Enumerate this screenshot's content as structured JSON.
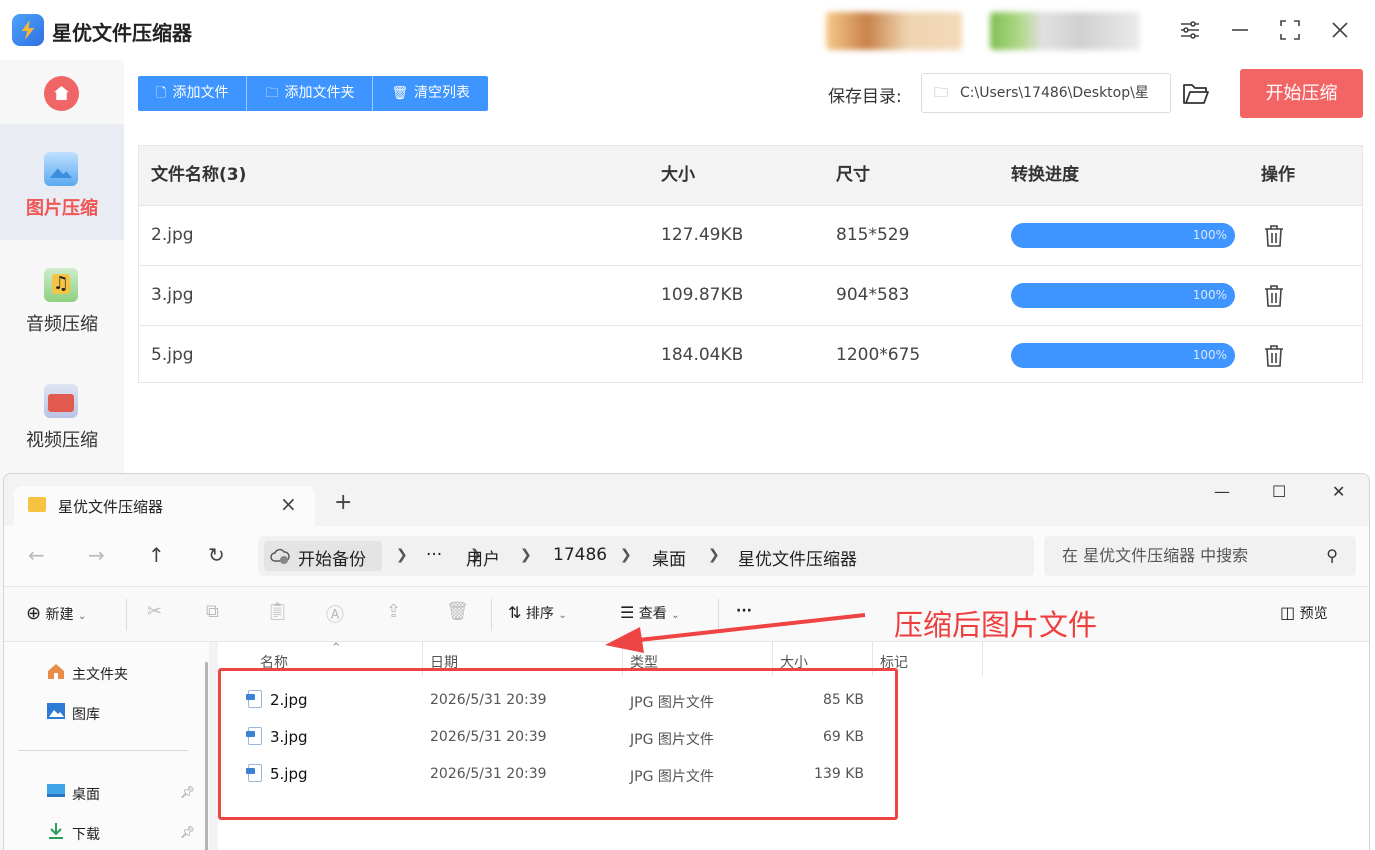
{
  "app": {
    "title": "星优文件压缩器",
    "sidebar": {
      "items": [
        {
          "label": "图片压缩",
          "active": true
        },
        {
          "label": "音频压缩",
          "active": false
        },
        {
          "label": "视频压缩",
          "active": false
        }
      ]
    },
    "toolbar": {
      "add_file": "添加文件",
      "add_folder": "添加文件夹",
      "clear_list": "清空列表"
    },
    "save": {
      "label": "保存目录:",
      "path": "C:\\Users\\17486\\Desktop\\星"
    },
    "start_button": "开始压缩",
    "table": {
      "headers": [
        "文件名称(3)",
        "大小",
        "尺寸",
        "转换进度",
        "操作"
      ],
      "rows": [
        {
          "name": "2.jpg",
          "size": "127.49KB",
          "dims": "815*529",
          "progress": "100%"
        },
        {
          "name": "3.jpg",
          "size": "109.87KB",
          "dims": "904*583",
          "progress": "100%"
        },
        {
          "name": "5.jpg",
          "size": "184.04KB",
          "dims": "1200*675",
          "progress": "100%"
        }
      ]
    },
    "colors": {
      "accent": "#3e95ff",
      "brand_red": "#f36464"
    }
  },
  "explorer": {
    "tab_title": "星优文件压缩器",
    "breadcrumb": [
      "开始备份",
      "···",
      "用户",
      "17486",
      "桌面",
      "星优文件压缩器"
    ],
    "search_placeholder": "在 星优文件压缩器 中搜索",
    "commands": {
      "new": "新建",
      "sort": "排序",
      "view": "查看",
      "more": "···",
      "preview": "预览"
    },
    "nav_pane": [
      {
        "label": "主文件夹",
        "pinned": false
      },
      {
        "label": "图库",
        "pinned": false
      },
      {
        "label": "桌面",
        "pinned": true
      },
      {
        "label": "下载",
        "pinned": true
      }
    ],
    "columns": [
      "名称",
      "日期",
      "类型",
      "大小",
      "标记"
    ],
    "files": [
      {
        "name": "2.jpg",
        "date": "2026/5/31 20:39",
        "type": "JPG 图片文件",
        "size": "85 KB"
      },
      {
        "name": "3.jpg",
        "date": "2026/5/31 20:39",
        "type": "JPG 图片文件",
        "size": "69 KB"
      },
      {
        "name": "5.jpg",
        "date": "2026/5/31 20:39",
        "type": "JPG 图片文件",
        "size": "139 KB"
      }
    ]
  },
  "annotation": {
    "text": "压缩后图片文件",
    "color": "#ee3e3e"
  }
}
